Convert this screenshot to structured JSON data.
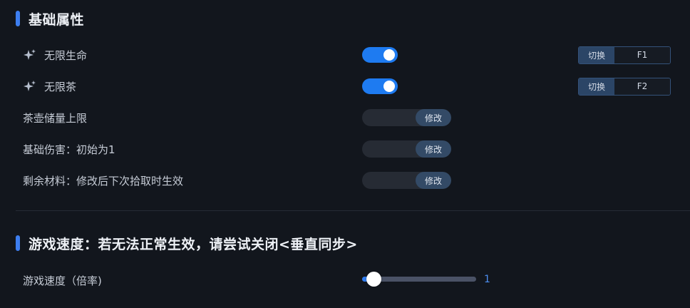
{
  "sections": {
    "basic": {
      "title": "基础属性"
    },
    "speed": {
      "title": "游戏速度：若无法正常生效，请尝试关闭<垂直同步>"
    }
  },
  "toggles": [
    {
      "label": "无限生命",
      "on": true,
      "hotkey_button": "切换",
      "hotkey": "F1",
      "icon": "sparkle-icon"
    },
    {
      "label": "无限茶",
      "on": true,
      "hotkey_button": "切换",
      "hotkey": "F2",
      "icon": "sparkle-icon"
    }
  ],
  "edits": [
    {
      "label": "茶壶储量上限",
      "value": "",
      "button": "修改"
    },
    {
      "label": "基础伤害：初始为1",
      "value": "",
      "button": "修改"
    },
    {
      "label": "剩余材料：修改后下次拾取时生效",
      "value": "",
      "button": "修改"
    }
  ],
  "speed": {
    "label": "游戏速度（倍率)",
    "value": "1",
    "fraction": 0.0
  },
  "colors": {
    "accent": "#1e7bf1",
    "background": "#12161d",
    "section_bar": "#3d7ef0"
  }
}
